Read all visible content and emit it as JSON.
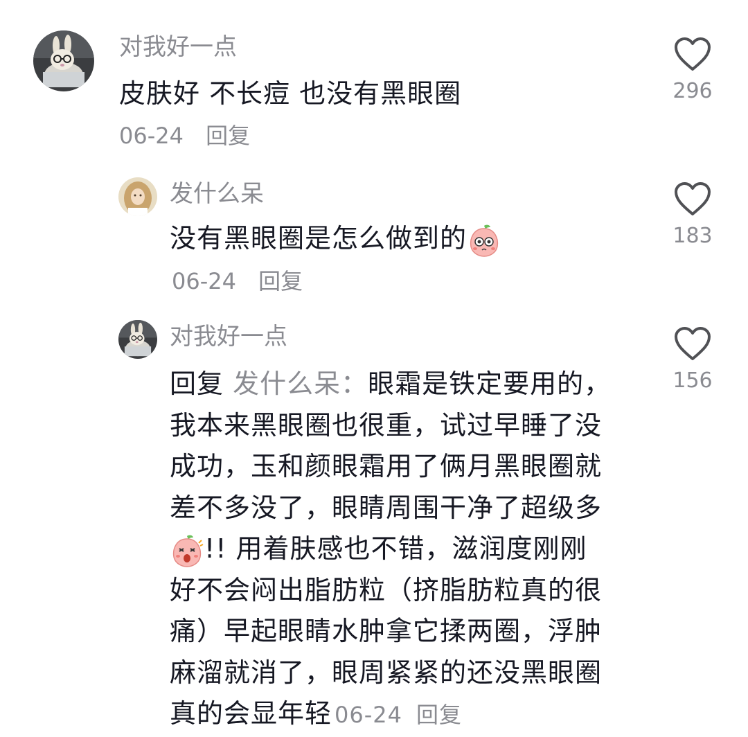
{
  "comments": [
    {
      "username": "对我好一点",
      "text": "皮肤好 不长痘 也没有黑眼圈",
      "date": "06-24",
      "reply_label": "回复",
      "likes": "296",
      "avatar": "bunny-avatar"
    },
    {
      "username": "发什么呆",
      "text": "没有黑眼圈是怎么做到的",
      "emoji": "peach-curious-emoji",
      "date": "06-24",
      "reply_label": "回复",
      "likes": "183",
      "avatar": "girl-avatar"
    },
    {
      "username": "对我好一点",
      "reply_prefix": "回复",
      "reply_to": "发什么呆：",
      "lines": [
        "眼霜是铁定要用的，",
        "我本来黑眼圈也很重，试过早睡了没",
        "成功，玉和颜眼霜用了俩月黑眼圈就",
        "差不多没了，眼睛周围干净了超级多",
        "!!  用着肤感也不错，滋润度刚刚",
        "好不会闷出脂肪粒（挤脂肪粒真的很",
        "痛）早起眼睛水肿拿它揉两圈，浮肿",
        "麻溜就消了，眼周紧紧的还没黑眼圈",
        "真的会显年轻"
      ],
      "emoji": "peach-shocked-emoji",
      "date": "06-24",
      "reply_label": "回复",
      "likes": "156",
      "avatar": "bunny-avatar"
    }
  ]
}
